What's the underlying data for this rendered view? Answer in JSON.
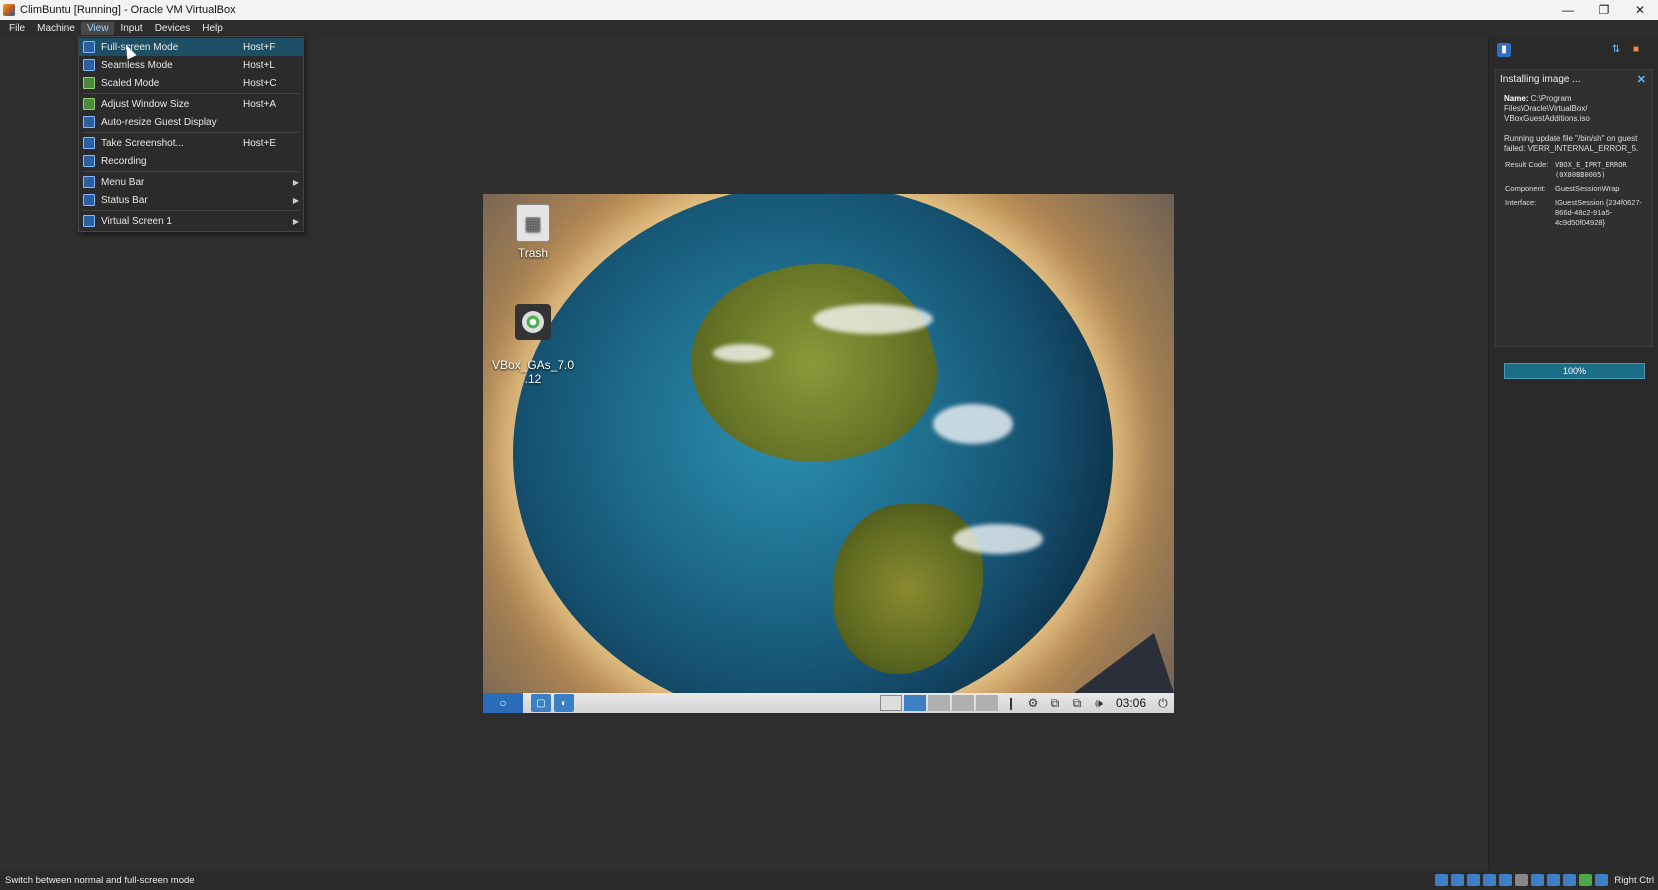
{
  "window": {
    "title": "ClimBuntu [Running] - Oracle VM VirtualBox"
  },
  "menubar": {
    "items": [
      "File",
      "Machine",
      "View",
      "Input",
      "Devices",
      "Help"
    ],
    "active": "View"
  },
  "view_menu": {
    "items": [
      {
        "label": "Full-screen Mode",
        "shortcut": "Host+F",
        "icon": "fullscreen-icon",
        "highlighted": true
      },
      {
        "label": "Seamless Mode",
        "shortcut": "Host+L",
        "icon": "seamless-icon"
      },
      {
        "label": "Scaled Mode",
        "shortcut": "Host+C",
        "icon": "scaled-icon"
      },
      {
        "label": "Adjust Window Size",
        "shortcut": "Host+A",
        "icon": "adjust-window-icon"
      },
      {
        "label": "Auto-resize Guest Display",
        "shortcut": "",
        "icon": "auto-resize-icon"
      },
      {
        "label": "Take Screenshot...",
        "shortcut": "Host+E",
        "icon": "screenshot-icon"
      },
      {
        "label": "Recording",
        "shortcut": "",
        "icon": "recording-icon"
      },
      {
        "label": "Menu Bar",
        "submenu": true,
        "icon": "menubar-icon"
      },
      {
        "label": "Status Bar",
        "submenu": true,
        "icon": "statusbar-icon"
      },
      {
        "label": "Virtual Screen 1",
        "submenu": true,
        "icon": "virtual-screen-icon"
      }
    ]
  },
  "guest": {
    "desktop_icons": [
      {
        "label": "Trash",
        "icon": "trash-icon"
      },
      {
        "label": "VBox_GAs_7.0\n.12",
        "icon": "disc-icon"
      }
    ],
    "taskbar": {
      "clock": "03:06"
    }
  },
  "notification": {
    "title": "Installing image ...",
    "name_label": "Name:",
    "name_value": "C:\\Program Files\\Oracle\\VirtualBox/ VBoxGuestAdditions.iso",
    "message": "Running update file \"/bin/sh\" on guest failed: VERR_INTERNAL_ERROR_5.",
    "result_code_label": "Result Code:",
    "result_code_value": "VBOX_E_IPRT_ERROR (0X80BB0005)",
    "component_label": "Component:",
    "component_value": "GuestSessionWrap",
    "interface_label": "Interface:",
    "interface_value": "IGuestSession {234f0627-866d-48c2-91a5-4c9d50f04928}",
    "progress_text": "100%",
    "progress_fraction": 1.0,
    "accent_color": "#1c6e86"
  },
  "statusbar": {
    "text": "Switch between normal and full-screen mode",
    "host_key": "Right Ctrl"
  }
}
